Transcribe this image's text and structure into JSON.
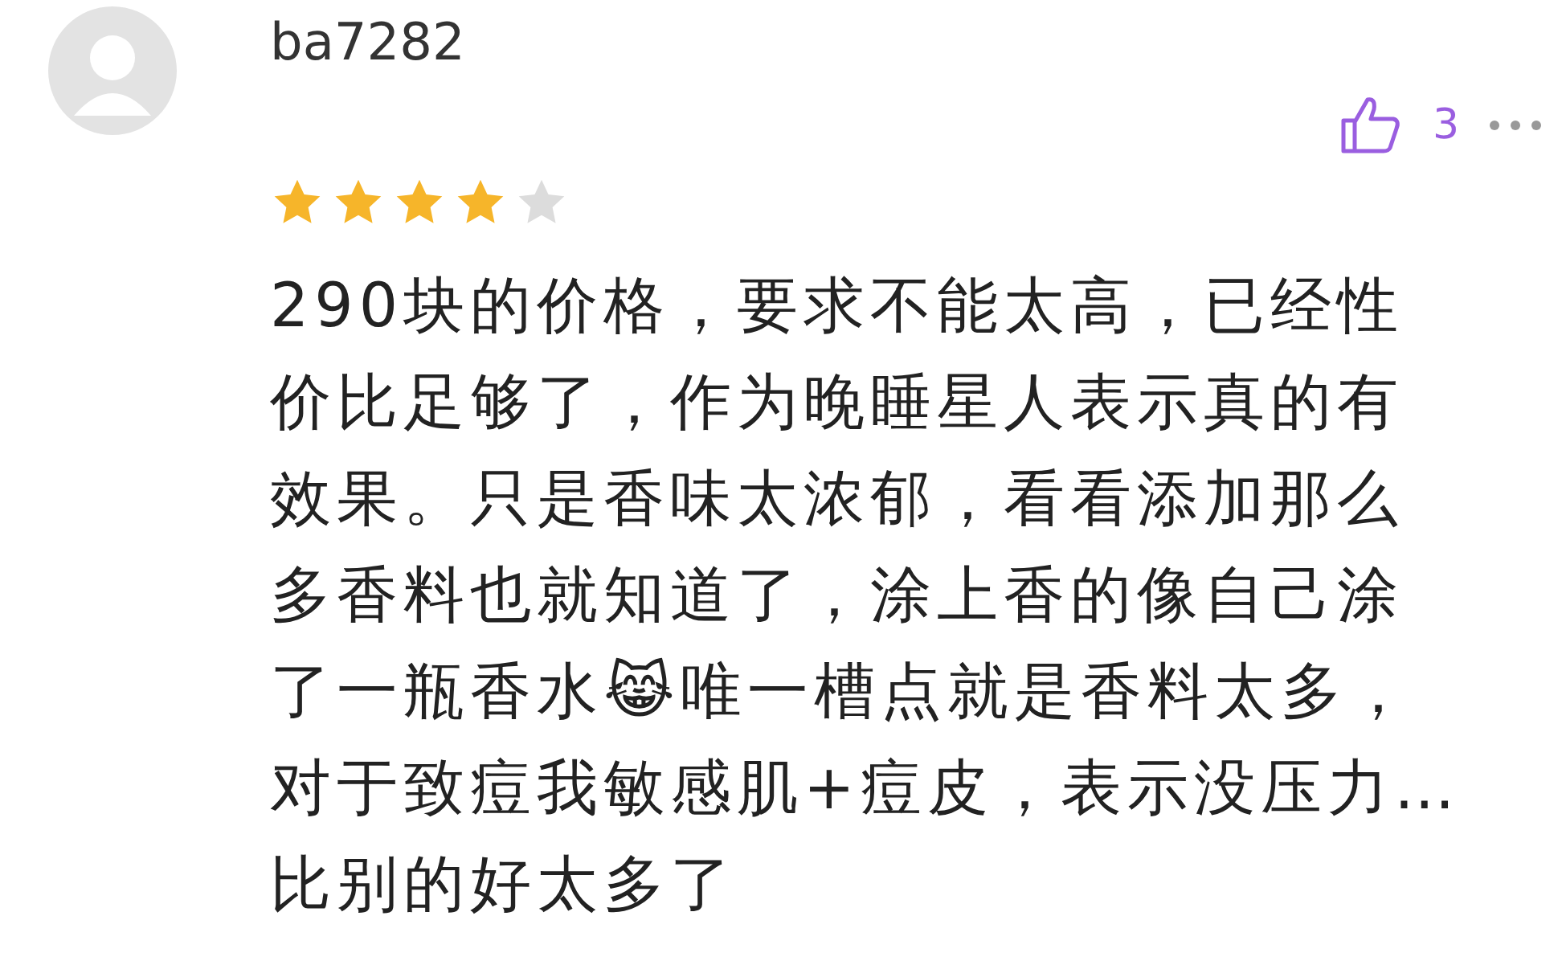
{
  "comment": {
    "username": "ba7282",
    "likes": "3",
    "stars": 4,
    "text": "290块的价格，要求不能太高，已经性价比足够了，作为晚睡星人表示真的有效果。只是香味太浓郁，看看添加那么多香料也就知道了，涂上香的像自己涂了一瓶香水😹唯一槽点就是香料太多，对于致痘我敏感肌+痘皮，表示没压力…比别的好太多了"
  }
}
